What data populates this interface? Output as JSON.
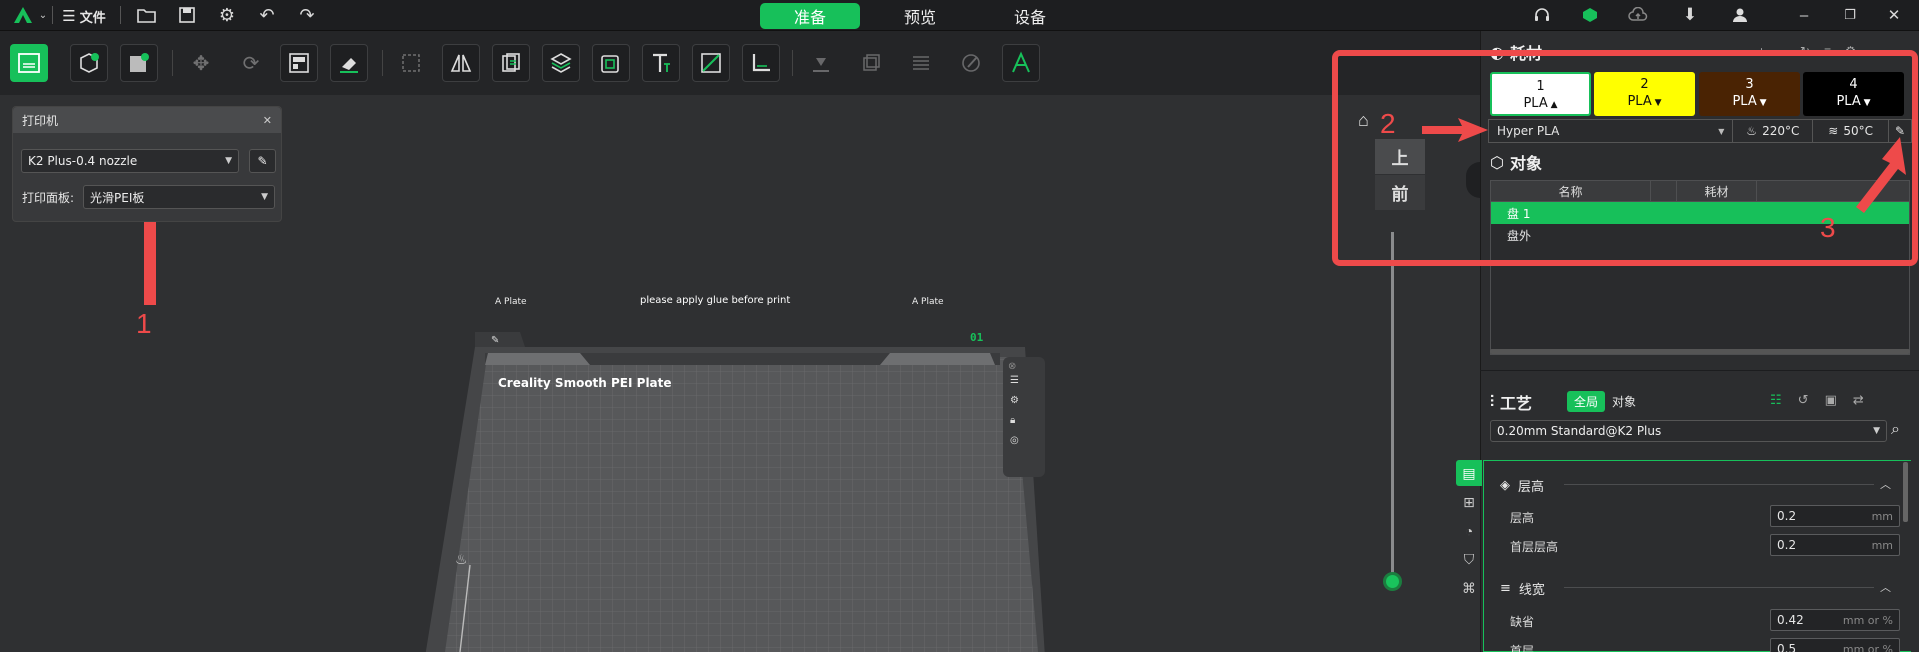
{
  "topbar": {
    "file_label": "文件",
    "tabs": [
      {
        "label": "准备",
        "active": true
      },
      {
        "label": "预览",
        "active": false
      },
      {
        "label": "设备",
        "active": false
      }
    ]
  },
  "toolbar": {
    "icons": [
      "slice-plate-icon",
      "add-object-icon",
      "add-plate-icon",
      "move-icon",
      "rotate-icon",
      "arrange-icon",
      "lay-on-face-icon",
      "scale-icon",
      "mirror-icon",
      "split-icon",
      "box-icon",
      "hollow-icon",
      "text-icon",
      "cut-icon",
      "measure-icon",
      "support-paint-icon",
      "seam-paint-icon",
      "variable-layer-icon",
      "color-paint-icon",
      "assembly-text-icon"
    ]
  },
  "printer_panel": {
    "title": "打印机",
    "printer": "K2 Plus-0.4 nozzle",
    "plate_label": "打印面板:",
    "plate_value": "光滑PEI板"
  },
  "bed": {
    "plate_name": "Creality Smooth PEI Plate",
    "tab_left": "A Plate",
    "tab_right": "A Plate",
    "notice": "please apply glue before print",
    "plate_index": "01"
  },
  "view": {
    "top": "上",
    "front": "前"
  },
  "filament": {
    "title": "耗材",
    "slots": [
      {
        "num": "1",
        "type": "PLA",
        "bg": "#ffffff",
        "fg": "#111111"
      },
      {
        "num": "2",
        "type": "PLA",
        "bg": "#ffff00",
        "fg": "#111111"
      },
      {
        "num": "3",
        "type": "PLA",
        "bg": "#4a2303",
        "fg": "#ffffff"
      },
      {
        "num": "4",
        "type": "PLA",
        "bg": "#000000",
        "fg": "#ffffff"
      }
    ],
    "material": "Hyper PLA",
    "nozzle_temp": "220°C",
    "bed_temp": "50°C"
  },
  "objects": {
    "title": "对象",
    "col_name": "名称",
    "col_filament": "耗材",
    "rows": [
      {
        "label": "盘 1",
        "selected": true
      },
      {
        "label": "盘外",
        "selected": false
      }
    ]
  },
  "process": {
    "title": "工艺",
    "toggle_global": "全局",
    "toggle_object": "对象",
    "preset": "0.20mm Standard@K2 Plus",
    "groups": [
      {
        "title": "层高",
        "params": [
          {
            "label": "层高",
            "value": "0.2",
            "unit": "mm"
          },
          {
            "label": "首层层高",
            "value": "0.2",
            "unit": "mm"
          }
        ]
      },
      {
        "title": "线宽",
        "params": [
          {
            "label": "缺省",
            "value": "0.42",
            "unit": "mm or %"
          },
          {
            "label": "首层",
            "value": "0.5",
            "unit": "mm or %"
          }
        ]
      }
    ]
  },
  "annotations": [
    "1",
    "2",
    "3"
  ],
  "colors": {
    "accent": "#17c05a",
    "annotation": "#ee4a4a"
  }
}
